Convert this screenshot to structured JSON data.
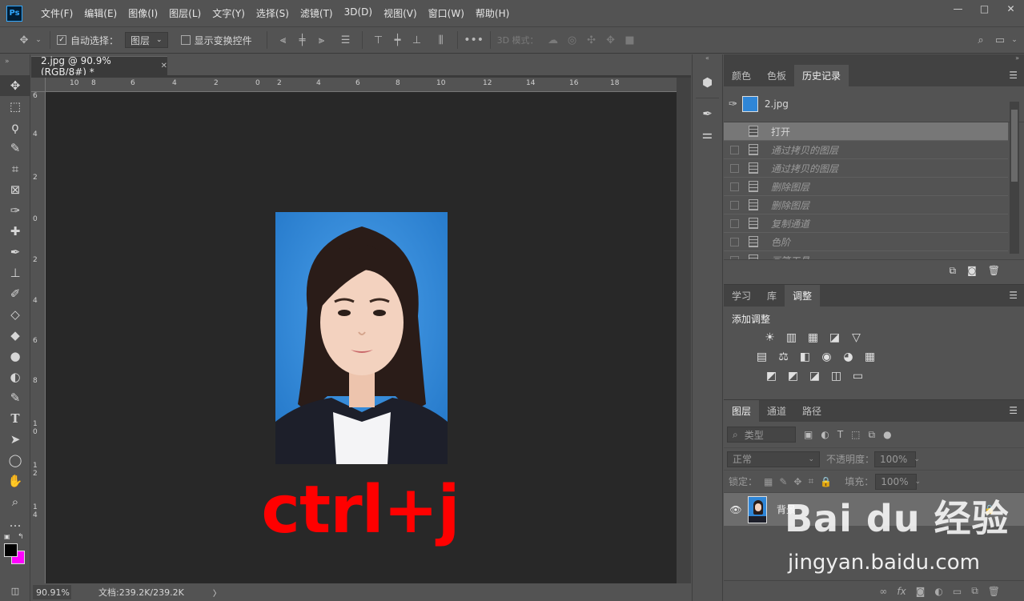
{
  "menubar": {
    "app_logo": "Ps",
    "items": [
      "文件(F)",
      "编辑(E)",
      "图像(I)",
      "图层(L)",
      "文字(Y)",
      "选择(S)",
      "滤镜(T)",
      "3D(D)",
      "视图(V)",
      "窗口(W)",
      "帮助(H)"
    ],
    "window_controls": [
      "—",
      "□",
      "✕"
    ]
  },
  "options": {
    "auto_select_label": "自动选择：",
    "auto_select_value": "图层",
    "show_transform_label": "显示变换控件",
    "mode_3d_label": "3D 模式："
  },
  "document": {
    "tab_title": "2.jpg @ 90.9%(RGB/8#) *",
    "ruler_h_labels": [
      "10",
      "8",
      "6",
      "4",
      "2",
      "0",
      "2",
      "4",
      "6",
      "8",
      "10",
      "12",
      "14",
      "16",
      "18"
    ],
    "ruler_v_labels": [
      "6",
      "4",
      "2",
      "0",
      "2",
      "4",
      "6",
      "8",
      "1 0",
      "1 2",
      "1 4"
    ],
    "overlay_text": "ctrl+j"
  },
  "status": {
    "zoom": "90.91%",
    "doc_info": "文档:239.2K/239.2K",
    "arrow": "〉"
  },
  "history_panel": {
    "tabs": [
      "颜色",
      "色板",
      "历史记录"
    ],
    "active_tab": "历史记录",
    "snapshot_name": "2.jpg",
    "items": [
      {
        "label": "打开",
        "state": "current"
      },
      {
        "label": "通过拷贝的图层",
        "state": "undone"
      },
      {
        "label": "通过拷贝的图层",
        "state": "undone"
      },
      {
        "label": "删除图层",
        "state": "undone"
      },
      {
        "label": "删除图层",
        "state": "undone"
      },
      {
        "label": "复制通道",
        "state": "undone"
      },
      {
        "label": "色阶",
        "state": "undone"
      },
      {
        "label": "画笔工具",
        "state": "undone"
      }
    ]
  },
  "adjust_panel": {
    "tabs": [
      "学习",
      "库",
      "调整"
    ],
    "active_tab": "调整",
    "title": "添加调整",
    "row1": [
      "☀",
      "▥",
      "▦",
      "◪",
      "▽"
    ],
    "row2": [
      "▤",
      "⚖",
      "◧",
      "◉",
      "◕",
      "▦"
    ],
    "row3": [
      "◩",
      "◩",
      "◪",
      "◫",
      "▭"
    ]
  },
  "layers_panel": {
    "tabs": [
      "图层",
      "通道",
      "路径"
    ],
    "active_tab": "图层",
    "filter_label": "类型",
    "blend_mode": "正常",
    "opacity_label": "不透明度：",
    "opacity_value": "100%",
    "lock_label": "锁定：",
    "fill_label": "填充：",
    "fill_value": "100%",
    "layer_name": "背景"
  },
  "watermark": {
    "brand": "Bai du 经验",
    "url": "jingyan.baidu.com"
  },
  "colors": {
    "foreground": "#000000",
    "background": "#ff00ff",
    "photo_bg": "#2f86d7",
    "overlay_red": "#ff0000"
  }
}
